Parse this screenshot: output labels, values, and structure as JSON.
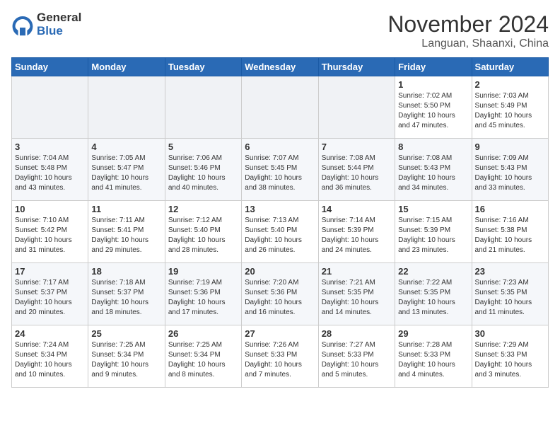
{
  "header": {
    "logo_general": "General",
    "logo_blue": "Blue",
    "month_title": "November 2024",
    "location": "Languan, Shaanxi, China"
  },
  "weekdays": [
    "Sunday",
    "Monday",
    "Tuesday",
    "Wednesday",
    "Thursday",
    "Friday",
    "Saturday"
  ],
  "weeks": [
    [
      {
        "day": "",
        "info": ""
      },
      {
        "day": "",
        "info": ""
      },
      {
        "day": "",
        "info": ""
      },
      {
        "day": "",
        "info": ""
      },
      {
        "day": "",
        "info": ""
      },
      {
        "day": "1",
        "info": "Sunrise: 7:02 AM\nSunset: 5:50 PM\nDaylight: 10 hours\nand 47 minutes."
      },
      {
        "day": "2",
        "info": "Sunrise: 7:03 AM\nSunset: 5:49 PM\nDaylight: 10 hours\nand 45 minutes."
      }
    ],
    [
      {
        "day": "3",
        "info": "Sunrise: 7:04 AM\nSunset: 5:48 PM\nDaylight: 10 hours\nand 43 minutes."
      },
      {
        "day": "4",
        "info": "Sunrise: 7:05 AM\nSunset: 5:47 PM\nDaylight: 10 hours\nand 41 minutes."
      },
      {
        "day": "5",
        "info": "Sunrise: 7:06 AM\nSunset: 5:46 PM\nDaylight: 10 hours\nand 40 minutes."
      },
      {
        "day": "6",
        "info": "Sunrise: 7:07 AM\nSunset: 5:45 PM\nDaylight: 10 hours\nand 38 minutes."
      },
      {
        "day": "7",
        "info": "Sunrise: 7:08 AM\nSunset: 5:44 PM\nDaylight: 10 hours\nand 36 minutes."
      },
      {
        "day": "8",
        "info": "Sunrise: 7:08 AM\nSunset: 5:43 PM\nDaylight: 10 hours\nand 34 minutes."
      },
      {
        "day": "9",
        "info": "Sunrise: 7:09 AM\nSunset: 5:43 PM\nDaylight: 10 hours\nand 33 minutes."
      }
    ],
    [
      {
        "day": "10",
        "info": "Sunrise: 7:10 AM\nSunset: 5:42 PM\nDaylight: 10 hours\nand 31 minutes."
      },
      {
        "day": "11",
        "info": "Sunrise: 7:11 AM\nSunset: 5:41 PM\nDaylight: 10 hours\nand 29 minutes."
      },
      {
        "day": "12",
        "info": "Sunrise: 7:12 AM\nSunset: 5:40 PM\nDaylight: 10 hours\nand 28 minutes."
      },
      {
        "day": "13",
        "info": "Sunrise: 7:13 AM\nSunset: 5:40 PM\nDaylight: 10 hours\nand 26 minutes."
      },
      {
        "day": "14",
        "info": "Sunrise: 7:14 AM\nSunset: 5:39 PM\nDaylight: 10 hours\nand 24 minutes."
      },
      {
        "day": "15",
        "info": "Sunrise: 7:15 AM\nSunset: 5:39 PM\nDaylight: 10 hours\nand 23 minutes."
      },
      {
        "day": "16",
        "info": "Sunrise: 7:16 AM\nSunset: 5:38 PM\nDaylight: 10 hours\nand 21 minutes."
      }
    ],
    [
      {
        "day": "17",
        "info": "Sunrise: 7:17 AM\nSunset: 5:37 PM\nDaylight: 10 hours\nand 20 minutes."
      },
      {
        "day": "18",
        "info": "Sunrise: 7:18 AM\nSunset: 5:37 PM\nDaylight: 10 hours\nand 18 minutes."
      },
      {
        "day": "19",
        "info": "Sunrise: 7:19 AM\nSunset: 5:36 PM\nDaylight: 10 hours\nand 17 minutes."
      },
      {
        "day": "20",
        "info": "Sunrise: 7:20 AM\nSunset: 5:36 PM\nDaylight: 10 hours\nand 16 minutes."
      },
      {
        "day": "21",
        "info": "Sunrise: 7:21 AM\nSunset: 5:35 PM\nDaylight: 10 hours\nand 14 minutes."
      },
      {
        "day": "22",
        "info": "Sunrise: 7:22 AM\nSunset: 5:35 PM\nDaylight: 10 hours\nand 13 minutes."
      },
      {
        "day": "23",
        "info": "Sunrise: 7:23 AM\nSunset: 5:35 PM\nDaylight: 10 hours\nand 11 minutes."
      }
    ],
    [
      {
        "day": "24",
        "info": "Sunrise: 7:24 AM\nSunset: 5:34 PM\nDaylight: 10 hours\nand 10 minutes."
      },
      {
        "day": "25",
        "info": "Sunrise: 7:25 AM\nSunset: 5:34 PM\nDaylight: 10 hours\nand 9 minutes."
      },
      {
        "day": "26",
        "info": "Sunrise: 7:25 AM\nSunset: 5:34 PM\nDaylight: 10 hours\nand 8 minutes."
      },
      {
        "day": "27",
        "info": "Sunrise: 7:26 AM\nSunset: 5:33 PM\nDaylight: 10 hours\nand 7 minutes."
      },
      {
        "day": "28",
        "info": "Sunrise: 7:27 AM\nSunset: 5:33 PM\nDaylight: 10 hours\nand 5 minutes."
      },
      {
        "day": "29",
        "info": "Sunrise: 7:28 AM\nSunset: 5:33 PM\nDaylight: 10 hours\nand 4 minutes."
      },
      {
        "day": "30",
        "info": "Sunrise: 7:29 AM\nSunset: 5:33 PM\nDaylight: 10 hours\nand 3 minutes."
      }
    ]
  ]
}
